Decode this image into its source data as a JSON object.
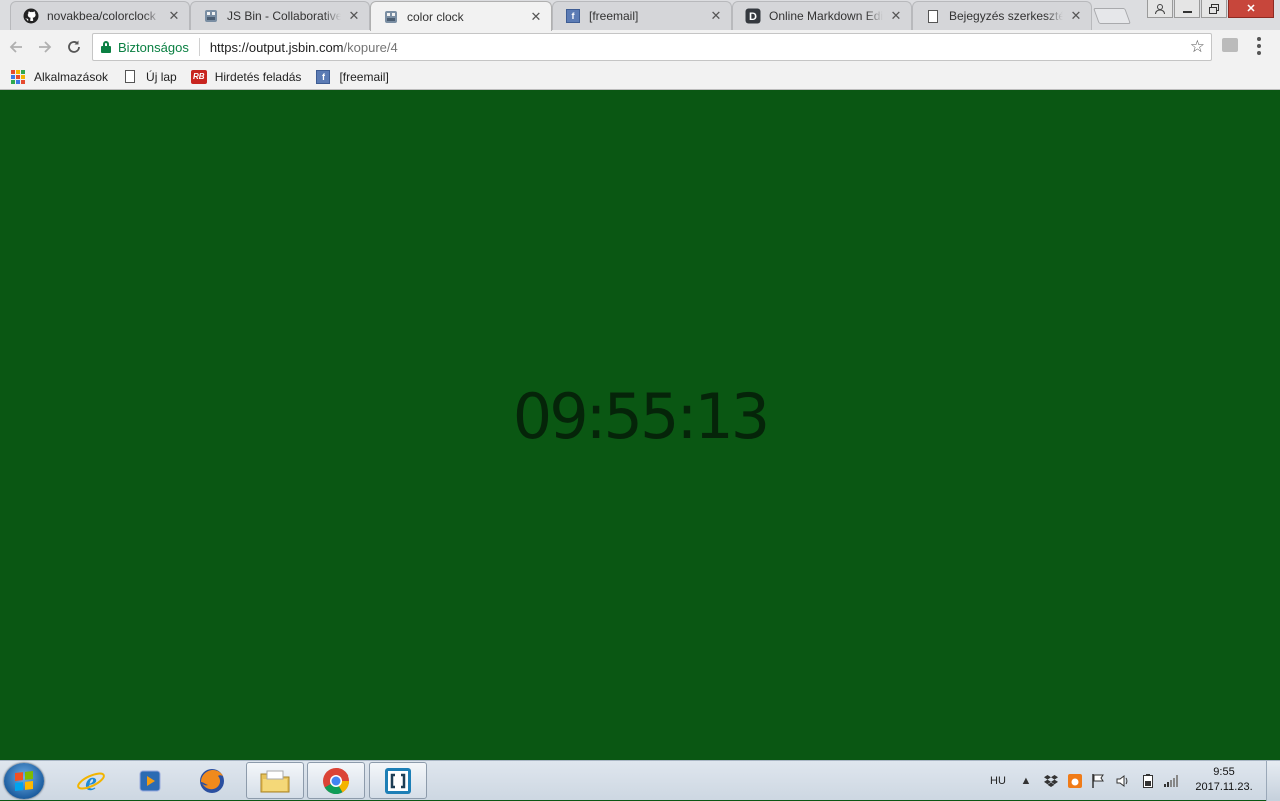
{
  "browser": {
    "tabs": [
      {
        "title": "novakbea/colorclock",
        "icon": "github-icon",
        "active": false
      },
      {
        "title": "JS Bin - Collaborative J",
        "icon": "jsbin-icon",
        "active": false
      },
      {
        "title": "color clock",
        "icon": "jsbin-icon",
        "active": true
      },
      {
        "title": "[freemail]",
        "icon": "freemail-icon",
        "active": false
      },
      {
        "title": "Online Markdown Edit",
        "icon": "dillinger-icon",
        "active": false
      },
      {
        "title": "Bejegyzés szerkesztés",
        "icon": "document-icon",
        "active": false
      }
    ],
    "omnibox": {
      "secure_label": "Biztonságos",
      "url_host": "https://output.jsbin.com",
      "url_path": "/kopure/4"
    },
    "bookmarks": [
      {
        "label": "Alkalmazások",
        "icon": "apps-grid-icon"
      },
      {
        "label": "Új lap",
        "icon": "document-icon"
      },
      {
        "label": "Hirdetés feladás",
        "icon": "rb-icon"
      },
      {
        "label": "[freemail]",
        "icon": "freemail-icon"
      }
    ]
  },
  "page": {
    "clock_text": "09:55:13",
    "background_color": "#0a5713",
    "text_color": "#051f08"
  },
  "taskbar": {
    "apps": [
      "internet-explorer-icon",
      "media-player-icon",
      "firefox-icon",
      "file-explorer-icon",
      "chrome-icon",
      "brackets-icon"
    ],
    "language": "HU",
    "time": "9:55",
    "date": "2017.11.23."
  }
}
